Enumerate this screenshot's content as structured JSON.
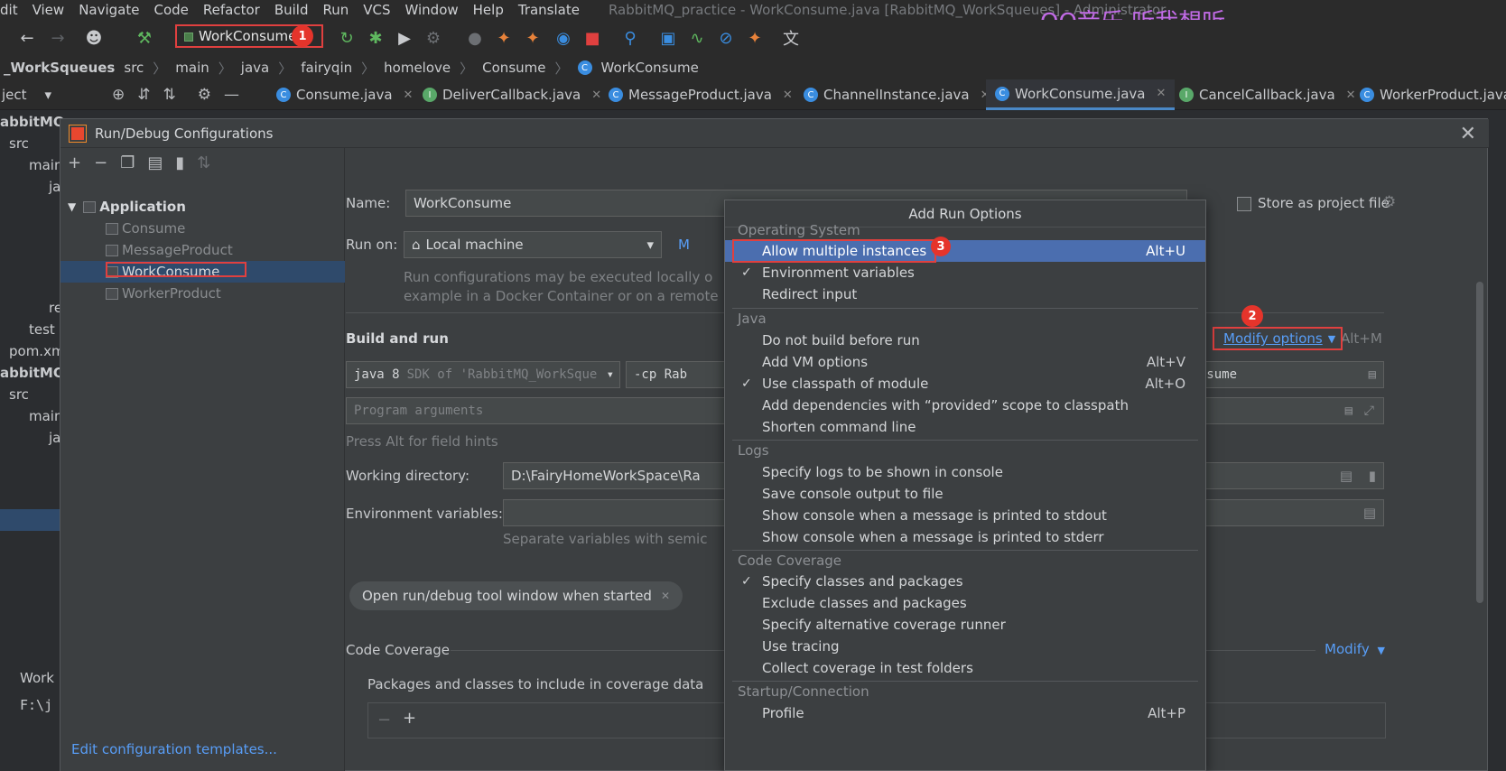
{
  "menubar": {
    "items": [
      "dit",
      "View",
      "Navigate",
      "Code",
      "Refactor",
      "Build",
      "Run",
      "VCS",
      "Window",
      "Help",
      "Translate"
    ],
    "window_title": "RabbitMQ_practice - WorkConsume.java [RabbitMQ_WorkSqueues] - Administrator",
    "overlay_text": "QQ音乐 听我想听"
  },
  "toolbar": {
    "run_config": "WorkConsume",
    "badge1": "1"
  },
  "breadcrumb": [
    "_WorkSqueues",
    "src",
    "main",
    "java",
    "fairyqin",
    "homelove",
    "Consume",
    "WorkConsume"
  ],
  "project_label": "ject",
  "tabs": [
    {
      "label": "Consume.java",
      "icon": "C"
    },
    {
      "label": "DeliverCallback.java",
      "icon": "I"
    },
    {
      "label": "MessageProduct.java",
      "icon": "C"
    },
    {
      "label": "ChannelInstance.java",
      "icon": "C"
    },
    {
      "label": "WorkConsume.java",
      "icon": "C"
    },
    {
      "label": "CancelCallback.java",
      "icon": "I"
    },
    {
      "label": "WorkerProduct.java",
      "icon": "C"
    }
  ],
  "left_tree": [
    "abbitMQ",
    "src",
    "main",
    "ja",
    "re",
    "test",
    "pom.xm",
    "abbitMQ",
    "src",
    "main",
    "ja",
    "Work",
    "F:\\j"
  ],
  "dialog": {
    "title": "Run/Debug Configurations",
    "tree": {
      "root": "Application",
      "children": [
        "Consume",
        "MessageProduct",
        "WorkConsume",
        "WorkerProduct"
      ]
    },
    "edit_templates": "Edit configuration templates..."
  },
  "form": {
    "name_label": "Name:",
    "name_value": "WorkConsume",
    "store_label": "Store as project file",
    "run_on_label": "Run on:",
    "run_on_value": "Local machine",
    "run_on_manage": "M",
    "run_info_1": "Run configurations may be executed locally o",
    "run_info_2": "example in a Docker Container or on a remote",
    "build_run_label": "Build and run",
    "modify_options": "Modify options",
    "modify_shortcut": "Alt+M",
    "badge2": "2",
    "jre_value": "java 8",
    "jre_hint": "SDK of 'RabbitMQ_WorkSque",
    "cp_value": "-cp Rab",
    "main_class": "me.WorkConsume",
    "program_args_placeholder": "Program arguments",
    "press_alt_hint": "Press Alt for field hints",
    "working_dir_label": "Working directory:",
    "working_dir_value": "D:\\FairyHomeWorkSpace\\Ra",
    "env_label": "Environment variables:",
    "env_hint": "Separate variables with semic",
    "chip_label": "Open run/debug tool window when started",
    "code_coverage_label": "Code Coverage",
    "modify_link": "Modify",
    "packages_label": "Packages and classes to include in coverage data"
  },
  "popup": {
    "title": "Add Run Options",
    "badge3": "3",
    "groups": [
      {
        "name": "Operating System",
        "items": [
          {
            "label": "Allow multiple instances",
            "shortcut": "Alt+U",
            "checked": false,
            "selected": true
          },
          {
            "label": "Environment variables",
            "shortcut": "",
            "checked": true
          },
          {
            "label": "Redirect input",
            "shortcut": "",
            "checked": false
          }
        ]
      },
      {
        "name": "Java",
        "items": [
          {
            "label": "Do not build before run",
            "shortcut": "",
            "checked": false
          },
          {
            "label": "Add VM options",
            "shortcut": "Alt+V",
            "checked": false
          },
          {
            "label": "Use classpath of module",
            "shortcut": "Alt+O",
            "checked": true
          },
          {
            "label": "Add dependencies with “provided” scope to classpath",
            "shortcut": "",
            "checked": false
          },
          {
            "label": "Shorten command line",
            "shortcut": "",
            "checked": false
          }
        ]
      },
      {
        "name": "Logs",
        "items": [
          {
            "label": "Specify logs to be shown in console",
            "shortcut": "",
            "checked": false
          },
          {
            "label": "Save console output to file",
            "shortcut": "",
            "checked": false
          },
          {
            "label": "Show console when a message is printed to stdout",
            "shortcut": "",
            "checked": false
          },
          {
            "label": "Show console when a message is printed to stderr",
            "shortcut": "",
            "checked": false
          }
        ]
      },
      {
        "name": "Code Coverage",
        "items": [
          {
            "label": "Specify classes and packages",
            "shortcut": "",
            "checked": true
          },
          {
            "label": "Exclude classes and packages",
            "shortcut": "",
            "checked": false
          },
          {
            "label": "Specify alternative coverage runner",
            "shortcut": "",
            "checked": false
          },
          {
            "label": "Use tracing",
            "shortcut": "",
            "checked": false
          },
          {
            "label": "Collect coverage in test folders",
            "shortcut": "",
            "checked": false
          }
        ]
      },
      {
        "name": "Startup/Connection",
        "items": [
          {
            "label": "Profile",
            "shortcut": "Alt+P",
            "checked": false
          }
        ]
      }
    ]
  },
  "colors": {
    "accent": "#4b6eaf",
    "link": "#589df6",
    "annotation_red": "#e0403f",
    "dialog_bg": "#3c3f41"
  }
}
